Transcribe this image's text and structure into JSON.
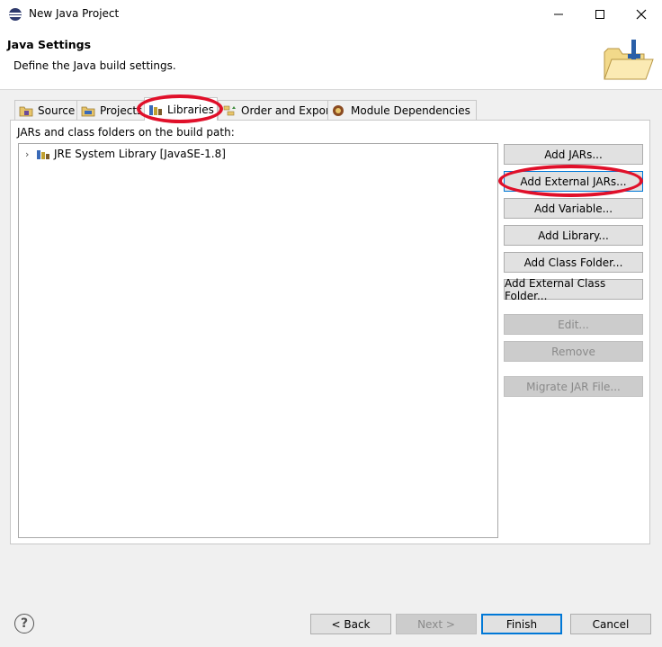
{
  "window": {
    "title": "New Java Project",
    "controls": [
      "minimize-icon",
      "maximize-icon",
      "close-icon"
    ]
  },
  "header": {
    "title": "Java Settings",
    "description": "Define the Java build settings."
  },
  "tabs": [
    {
      "label": "Source",
      "icon": "source-folder-icon"
    },
    {
      "label": "Projects",
      "icon": "projects-icon"
    },
    {
      "label": "Libraries",
      "icon": "library-icon",
      "active": true
    },
    {
      "label": "Order and Export",
      "icon": "order-export-icon"
    },
    {
      "label": "Module Dependencies",
      "icon": "module-icon"
    }
  ],
  "libraries": {
    "label": "JARs and class folders on the build path:",
    "tree": [
      {
        "label": "JRE System Library [JavaSE-1.8]",
        "icon": "jre-library-icon",
        "expanded": false
      }
    ]
  },
  "buttons": {
    "add_jars": "Add JARs...",
    "add_external_jars": "Add External JARs...",
    "add_variable": "Add Variable...",
    "add_library": "Add Library...",
    "add_class_folder": "Add Class Folder...",
    "add_external_class_folder": "Add External Class Folder...",
    "edit": "Edit...",
    "remove": "Remove",
    "migrate_jar": "Migrate JAR File..."
  },
  "footer": {
    "help": "?",
    "back": "< Back",
    "next": "Next >",
    "finish": "Finish",
    "cancel": "Cancel"
  },
  "colors": {
    "annotation": "#e0102a",
    "focus": "#0078d7"
  }
}
